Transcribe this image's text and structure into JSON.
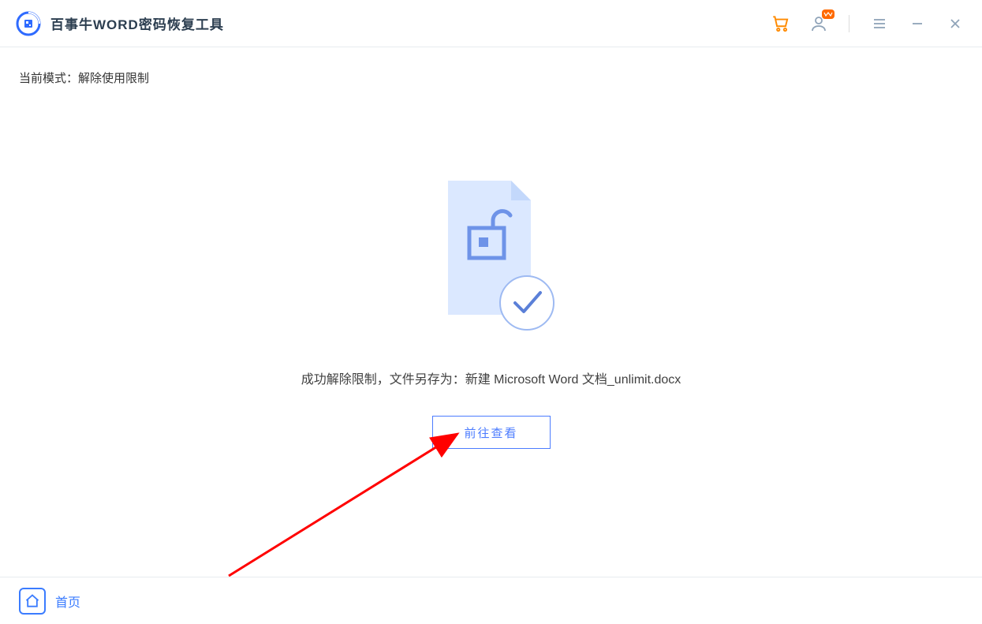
{
  "header": {
    "title": "百事牛WORD密码恢复工具"
  },
  "mode": {
    "label": "当前模式：",
    "value": "解除使用限制"
  },
  "result": {
    "prefix": "成功解除限制，文件另存为：",
    "filename": "新建 Microsoft Word 文档_unlimit.docx"
  },
  "actions": {
    "view_label": "前往查看"
  },
  "footer": {
    "home_label": "首页"
  },
  "colors": {
    "accent": "#3b7cff",
    "arrow": "#ff0000",
    "cart": "#ff8a00"
  }
}
